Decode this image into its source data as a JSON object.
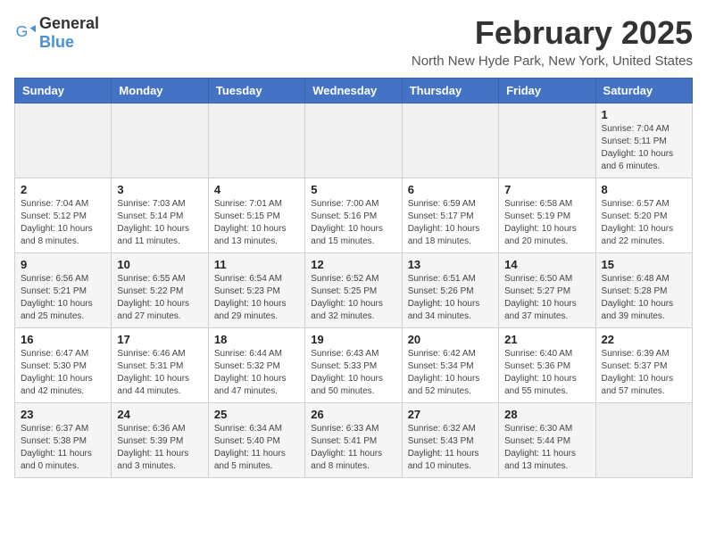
{
  "header": {
    "logo_general": "General",
    "logo_blue": "Blue",
    "title": "February 2025",
    "subtitle": "North New Hyde Park, New York, United States"
  },
  "days_of_week": [
    "Sunday",
    "Monday",
    "Tuesday",
    "Wednesday",
    "Thursday",
    "Friday",
    "Saturday"
  ],
  "weeks": [
    [
      {
        "day": "",
        "info": ""
      },
      {
        "day": "",
        "info": ""
      },
      {
        "day": "",
        "info": ""
      },
      {
        "day": "",
        "info": ""
      },
      {
        "day": "",
        "info": ""
      },
      {
        "day": "",
        "info": ""
      },
      {
        "day": "1",
        "info": "Sunrise: 7:04 AM\nSunset: 5:11 PM\nDaylight: 10 hours\nand 6 minutes."
      }
    ],
    [
      {
        "day": "2",
        "info": "Sunrise: 7:04 AM\nSunset: 5:12 PM\nDaylight: 10 hours\nand 8 minutes."
      },
      {
        "day": "3",
        "info": "Sunrise: 7:03 AM\nSunset: 5:14 PM\nDaylight: 10 hours\nand 11 minutes."
      },
      {
        "day": "4",
        "info": "Sunrise: 7:01 AM\nSunset: 5:15 PM\nDaylight: 10 hours\nand 13 minutes."
      },
      {
        "day": "5",
        "info": "Sunrise: 7:00 AM\nSunset: 5:16 PM\nDaylight: 10 hours\nand 15 minutes."
      },
      {
        "day": "6",
        "info": "Sunrise: 6:59 AM\nSunset: 5:17 PM\nDaylight: 10 hours\nand 18 minutes."
      },
      {
        "day": "7",
        "info": "Sunrise: 6:58 AM\nSunset: 5:19 PM\nDaylight: 10 hours\nand 20 minutes."
      },
      {
        "day": "8",
        "info": "Sunrise: 6:57 AM\nSunset: 5:20 PM\nDaylight: 10 hours\nand 22 minutes."
      }
    ],
    [
      {
        "day": "9",
        "info": "Sunrise: 6:56 AM\nSunset: 5:21 PM\nDaylight: 10 hours\nand 25 minutes."
      },
      {
        "day": "10",
        "info": "Sunrise: 6:55 AM\nSunset: 5:22 PM\nDaylight: 10 hours\nand 27 minutes."
      },
      {
        "day": "11",
        "info": "Sunrise: 6:54 AM\nSunset: 5:23 PM\nDaylight: 10 hours\nand 29 minutes."
      },
      {
        "day": "12",
        "info": "Sunrise: 6:52 AM\nSunset: 5:25 PM\nDaylight: 10 hours\nand 32 minutes."
      },
      {
        "day": "13",
        "info": "Sunrise: 6:51 AM\nSunset: 5:26 PM\nDaylight: 10 hours\nand 34 minutes."
      },
      {
        "day": "14",
        "info": "Sunrise: 6:50 AM\nSunset: 5:27 PM\nDaylight: 10 hours\nand 37 minutes."
      },
      {
        "day": "15",
        "info": "Sunrise: 6:48 AM\nSunset: 5:28 PM\nDaylight: 10 hours\nand 39 minutes."
      }
    ],
    [
      {
        "day": "16",
        "info": "Sunrise: 6:47 AM\nSunset: 5:30 PM\nDaylight: 10 hours\nand 42 minutes."
      },
      {
        "day": "17",
        "info": "Sunrise: 6:46 AM\nSunset: 5:31 PM\nDaylight: 10 hours\nand 44 minutes."
      },
      {
        "day": "18",
        "info": "Sunrise: 6:44 AM\nSunset: 5:32 PM\nDaylight: 10 hours\nand 47 minutes."
      },
      {
        "day": "19",
        "info": "Sunrise: 6:43 AM\nSunset: 5:33 PM\nDaylight: 10 hours\nand 50 minutes."
      },
      {
        "day": "20",
        "info": "Sunrise: 6:42 AM\nSunset: 5:34 PM\nDaylight: 10 hours\nand 52 minutes."
      },
      {
        "day": "21",
        "info": "Sunrise: 6:40 AM\nSunset: 5:36 PM\nDaylight: 10 hours\nand 55 minutes."
      },
      {
        "day": "22",
        "info": "Sunrise: 6:39 AM\nSunset: 5:37 PM\nDaylight: 10 hours\nand 57 minutes."
      }
    ],
    [
      {
        "day": "23",
        "info": "Sunrise: 6:37 AM\nSunset: 5:38 PM\nDaylight: 11 hours\nand 0 minutes."
      },
      {
        "day": "24",
        "info": "Sunrise: 6:36 AM\nSunset: 5:39 PM\nDaylight: 11 hours\nand 3 minutes."
      },
      {
        "day": "25",
        "info": "Sunrise: 6:34 AM\nSunset: 5:40 PM\nDaylight: 11 hours\nand 5 minutes."
      },
      {
        "day": "26",
        "info": "Sunrise: 6:33 AM\nSunset: 5:41 PM\nDaylight: 11 hours\nand 8 minutes."
      },
      {
        "day": "27",
        "info": "Sunrise: 6:32 AM\nSunset: 5:43 PM\nDaylight: 11 hours\nand 10 minutes."
      },
      {
        "day": "28",
        "info": "Sunrise: 6:30 AM\nSunset: 5:44 PM\nDaylight: 11 hours\nand 13 minutes."
      },
      {
        "day": "",
        "info": ""
      }
    ]
  ]
}
